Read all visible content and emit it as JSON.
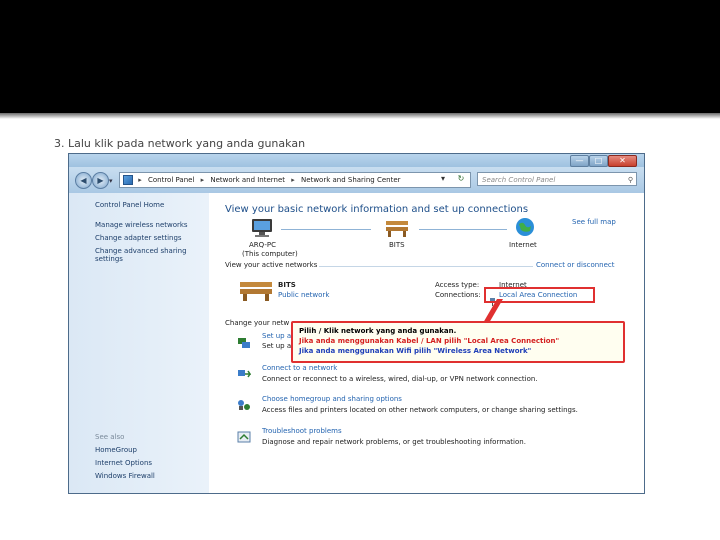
{
  "caption": "3. Lalu klik pada network yang anda gunakan",
  "window": {
    "buttons": {
      "minimize": "—",
      "maximize": "□",
      "close": "✕"
    },
    "address": {
      "icon": "control-panel-icon",
      "segments": [
        "Control Panel",
        "Network and Internet",
        "Network and Sharing Center"
      ],
      "dropdown": "▾",
      "refresh": "↻"
    },
    "search_placeholder": "Search Control Panel"
  },
  "sidebar": {
    "home": "Control Panel Home",
    "tasks": [
      "Manage wireless networks",
      "Change adapter settings",
      "Change advanced sharing",
      "settings"
    ],
    "see_also_header": "See also",
    "see_also": [
      "HomeGroup",
      "Internet Options",
      "Windows Firewall"
    ]
  },
  "main": {
    "title": "View your basic network information and set up connections",
    "see_full_map": "See full map",
    "map": {
      "computer": "ARQ-PC",
      "computer_sub": "(This computer)",
      "network": "BITS",
      "internet": "Internet"
    },
    "active_networks_header": "View your active networks",
    "connect_disconnect": "Connect or disconnect",
    "active_network": {
      "name": "BITS",
      "type": "Public network",
      "access_type_label": "Access type:",
      "access_type_value": "Internet",
      "connections_label": "Connections:",
      "connection_value": "Local Area Connection"
    },
    "change_header": "Change your netw",
    "tasks": [
      {
        "title": "Set up a",
        "desc": "Set up a"
      },
      {
        "title": "Connect to a network",
        "desc": "Connect or reconnect to a wireless, wired, dial-up, or VPN network connection."
      },
      {
        "title": "Choose homegroup and sharing options",
        "desc": "Access files and printers located on other network computers, or change sharing settings."
      },
      {
        "title": "Troubleshoot problems",
        "desc": "Diagnose and repair network problems, or get troubleshooting information."
      }
    ]
  },
  "callout": {
    "line1": "Pilih / Klik network yang anda gunakan.",
    "line2": "Jika anda menggunakan Kabel / LAN pilih \"Local Area Connection\"",
    "line3": "Jika anda menggunakan Wifi pilih \"Wireless Area Network\"",
    "colors": {
      "line1": "#000000",
      "line2": "#d42020",
      "line3": "#1f3fb8",
      "border": "#e03030"
    }
  }
}
